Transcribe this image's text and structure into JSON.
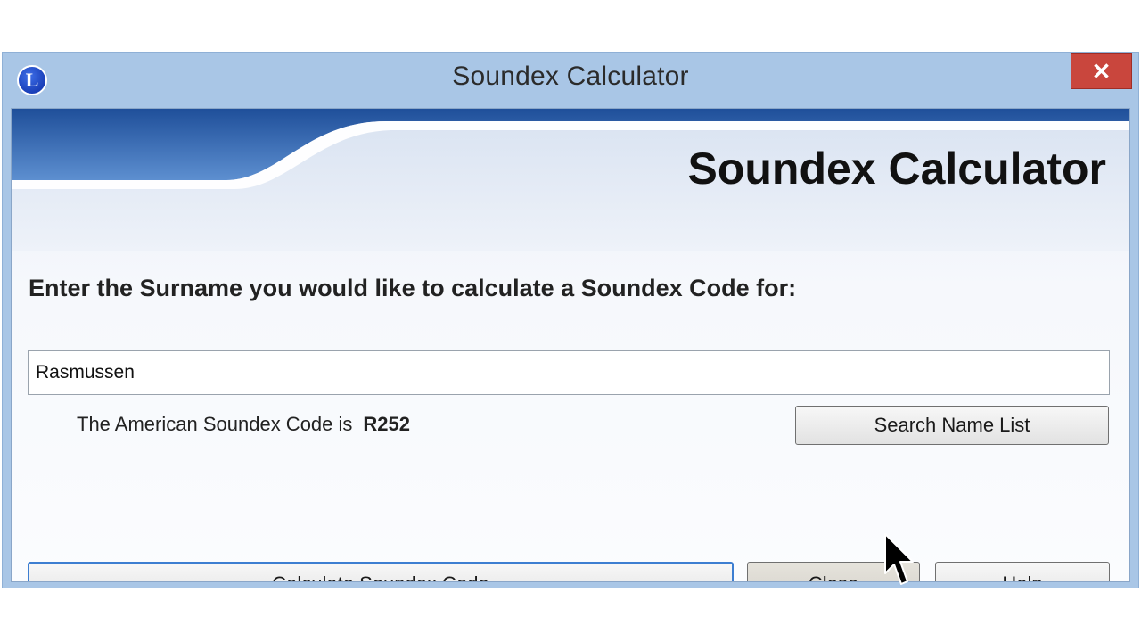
{
  "window": {
    "title": "Soundex Calculator",
    "icon_letter": "L",
    "close_glyph": "✕"
  },
  "banner": {
    "title": "Soundex Calculator"
  },
  "form": {
    "prompt": "Enter the Surname you would like to calculate a Soundex Code for:",
    "surname_value": "Rasmussen",
    "result_label": "The American Soundex Code is",
    "result_code": "R252"
  },
  "buttons": {
    "search": "Search Name List",
    "calc_pre": "Calculate ",
    "calc_accel": "S",
    "calc_post": "oundex Code",
    "close_accel": "C",
    "close_post": "lose",
    "help_accel": "H",
    "help_post": "elp"
  },
  "colors": {
    "accent_blue": "#2c63b0",
    "close_red": "#c9463d"
  },
  "icons": {
    "app": "circle-l-icon",
    "close": "close-icon",
    "cursor": "mouse-pointer-icon"
  }
}
